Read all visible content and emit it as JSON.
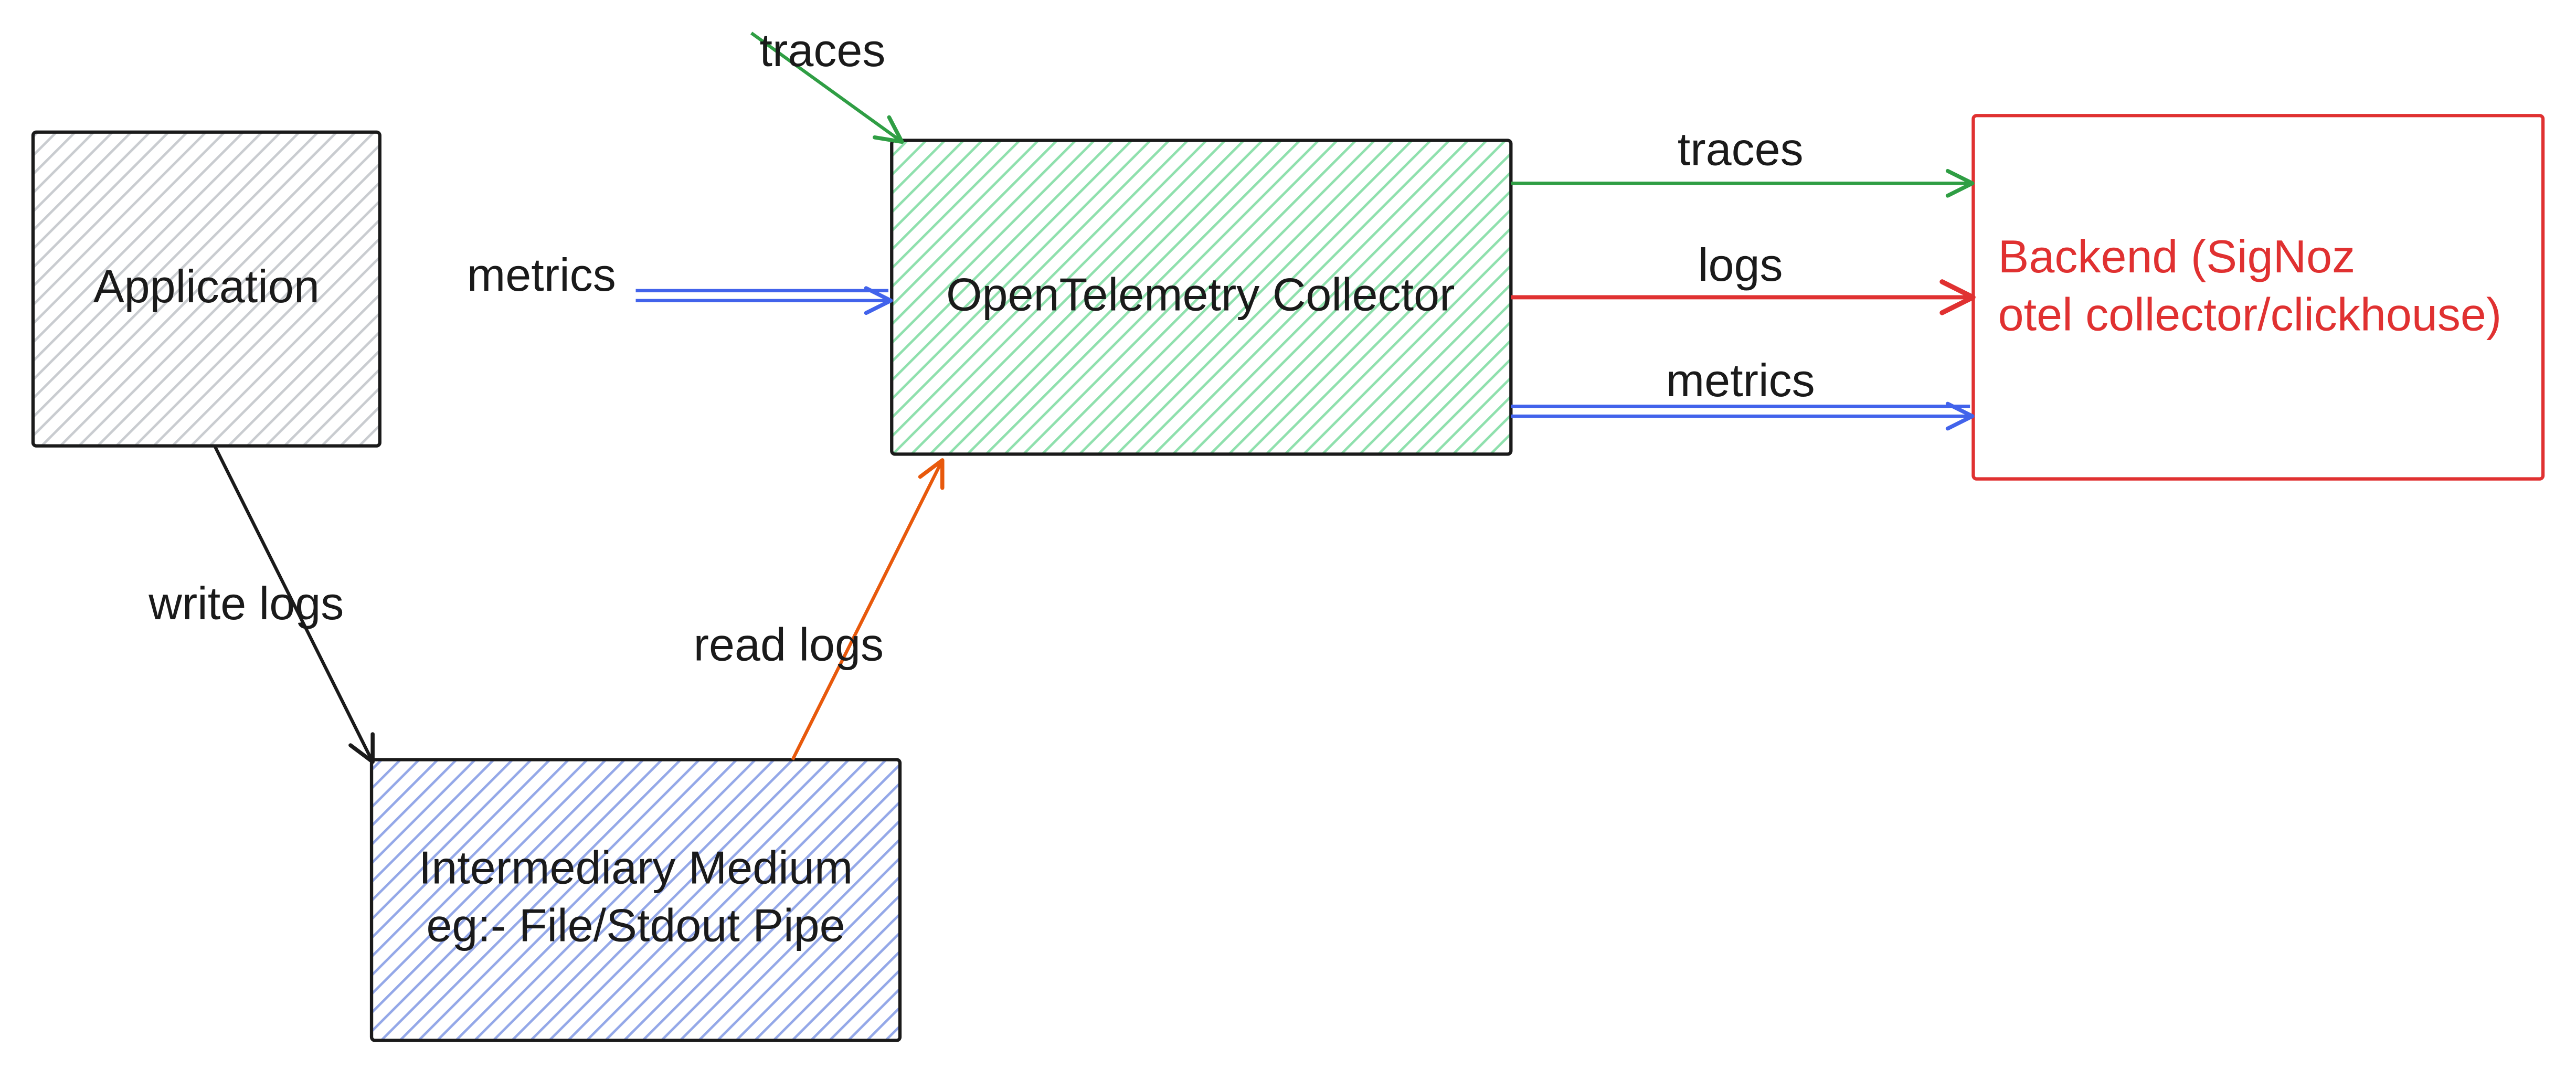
{
  "nodes": {
    "application": {
      "label": "Application",
      "fill_hatch": "#d0d3d6",
      "stroke": "#1a1a1a"
    },
    "collector": {
      "label": "OpenTelemetry Collector",
      "fill_hatch": "#6fcf97",
      "stroke": "#1a1a1a"
    },
    "intermediary": {
      "line1": "Intermediary Medium",
      "line2": "eg:- File/Stdout Pipe",
      "fill_hatch": "#5a7bd8",
      "stroke": "#1a1a1a"
    },
    "backend": {
      "line1": "Backend (SigNoz",
      "line2": "otel collector/clickhouse)",
      "stroke": "#e03131"
    }
  },
  "edges": {
    "traces_in": {
      "label": "traces",
      "color": "#2f9e44"
    },
    "metrics_in": {
      "label": "metrics",
      "color": "#4263eb"
    },
    "write_logs": {
      "label": "write logs",
      "color": "#1a1a1a"
    },
    "read_logs": {
      "label": "read logs",
      "color": "#e8590c"
    },
    "traces_out": {
      "label": "traces",
      "color": "#2f9e44"
    },
    "logs_out": {
      "label": "logs",
      "color": "#e03131"
    },
    "metrics_out": {
      "label": "metrics",
      "color": "#4263eb"
    }
  },
  "colors": {
    "black": "#1a1a1a",
    "green": "#2f9e44",
    "blue": "#4263eb",
    "orange": "#e8590c",
    "red": "#e03131"
  }
}
